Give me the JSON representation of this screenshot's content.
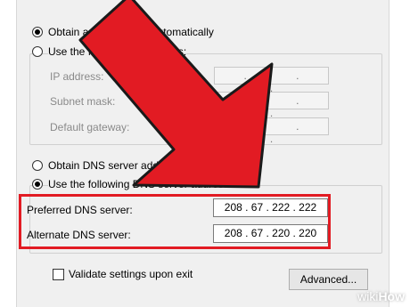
{
  "ip_section": {
    "auto_ip_label": "Obtain an IP address automatically",
    "manual_ip_label": "Use the following IP address:",
    "ip_address_label": "IP address:",
    "subnet_label": "Subnet mask:",
    "gateway_label": "Default gateway:",
    "dots": ". . ."
  },
  "dns_section": {
    "auto_dns_label": "Obtain DNS server address automatically",
    "manual_dns_label": "Use the following DNS server addresses:",
    "preferred_label": "Preferred DNS server:",
    "preferred_value": "208 . 67 . 222 . 222",
    "alternate_label": "Alternate DNS server:",
    "alternate_value": "208 . 67 . 220 . 220"
  },
  "footer": {
    "validate_label": "Validate settings upon exit",
    "advanced_label": "Advanced..."
  },
  "watermark": {
    "part1": "wiki",
    "part2": "How"
  },
  "colors": {
    "highlight": "#e21b23",
    "arrow": "#e21b23",
    "panel": "#f0f0f0"
  }
}
